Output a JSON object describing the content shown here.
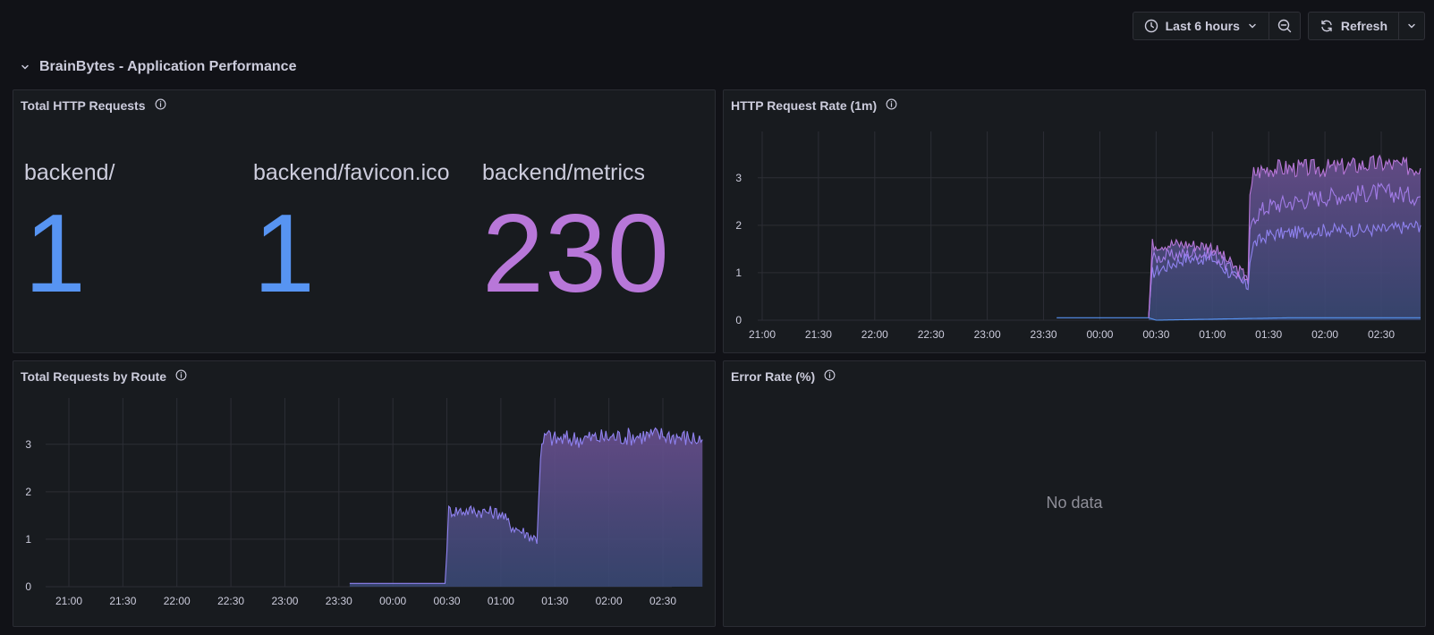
{
  "toolbar": {
    "time_range_label": "Last 6 hours",
    "refresh_label": "Refresh"
  },
  "row": {
    "title": "BrainBytes - Application Performance"
  },
  "colors": {
    "blue": "#5794f2",
    "purple": "#b877d9"
  },
  "panels": {
    "total_requests": {
      "title": "Total HTTP Requests",
      "stats": [
        {
          "label": "backend/",
          "value": "1",
          "color": "#5794f2"
        },
        {
          "label": "backend/favicon.ico",
          "value": "1",
          "color": "#5794f2"
        },
        {
          "label": "backend/metrics",
          "value": "230",
          "color": "#b877d9"
        }
      ]
    },
    "request_rate": {
      "title": "HTTP Request Rate (1m)"
    },
    "requests_by_route": {
      "title": "Total Requests by Route"
    },
    "error_rate": {
      "title": "Error Rate (%)",
      "no_data": "No data"
    }
  },
  "chart_data": [
    {
      "type": "area",
      "title": "HTTP Request Rate (1m)",
      "x_ticks": [
        "21:00",
        "21:30",
        "22:00",
        "22:30",
        "23:00",
        "23:30",
        "00:00",
        "00:30",
        "01:00",
        "01:30",
        "02:00",
        "02:30"
      ],
      "y_ticks": [
        0,
        1,
        2,
        3
      ],
      "ylim": [
        0,
        3.9
      ],
      "grid": true,
      "series": [
        {
          "color": "#5794f2",
          "x": [
            "23:37",
            "00:26",
            "00:30",
            "01:40",
            "01:43",
            "02:51"
          ],
          "values": [
            0.05,
            0.05,
            0.0,
            0.05,
            0.05,
            0.05
          ]
        },
        {
          "color": "#8f82f0",
          "x": [
            "00:26",
            "00:28",
            "00:45",
            "01:00",
            "01:12",
            "01:19",
            "01:20",
            "01:22",
            "01:30",
            "02:00",
            "02:30",
            "02:51"
          ],
          "values": [
            0.05,
            1.0,
            1.3,
            1.3,
            0.9,
            0.7,
            1.3,
            1.6,
            1.8,
            1.9,
            1.9,
            2.0
          ]
        },
        {
          "color": "#a27ce8",
          "x": [
            "00:26",
            "00:28",
            "00:45",
            "01:00",
            "01:12",
            "01:19",
            "01:20",
            "01:22",
            "01:30",
            "02:00",
            "02:30",
            "02:51"
          ],
          "values": [
            0.05,
            1.3,
            1.4,
            1.4,
            1.0,
            0.8,
            1.8,
            2.2,
            2.4,
            2.6,
            2.7,
            2.6
          ]
        },
        {
          "color": "#b877d9",
          "x": [
            "00:26",
            "00:28",
            "00:45",
            "01:00",
            "01:12",
            "01:19",
            "01:20",
            "01:22",
            "01:30",
            "02:00",
            "02:30",
            "02:51"
          ],
          "values": [
            0.05,
            1.6,
            1.6,
            1.55,
            1.1,
            0.9,
            2.5,
            3.1,
            3.2,
            3.2,
            3.3,
            3.2
          ]
        }
      ]
    },
    {
      "type": "area",
      "title": "Total Requests by Route",
      "x_ticks": [
        "21:00",
        "21:30",
        "22:00",
        "22:30",
        "23:00",
        "23:30",
        "00:00",
        "00:30",
        "01:00",
        "01:30",
        "02:00",
        "02:30"
      ],
      "y_ticks": [
        0,
        1,
        2,
        3
      ],
      "ylim": [
        0,
        3.9
      ],
      "grid": true,
      "series": [
        {
          "color": "#8f82f0",
          "x": [
            "23:36",
            "00:29",
            "00:31",
            "00:45",
            "01:00",
            "01:05",
            "01:20",
            "01:22",
            "01:25",
            "01:30",
            "02:00",
            "02:30",
            "02:52"
          ],
          "values": [
            0.07,
            0.07,
            1.6,
            1.6,
            1.55,
            1.3,
            1.0,
            2.8,
            3.2,
            3.1,
            3.15,
            3.2,
            3.1
          ]
        }
      ]
    }
  ]
}
